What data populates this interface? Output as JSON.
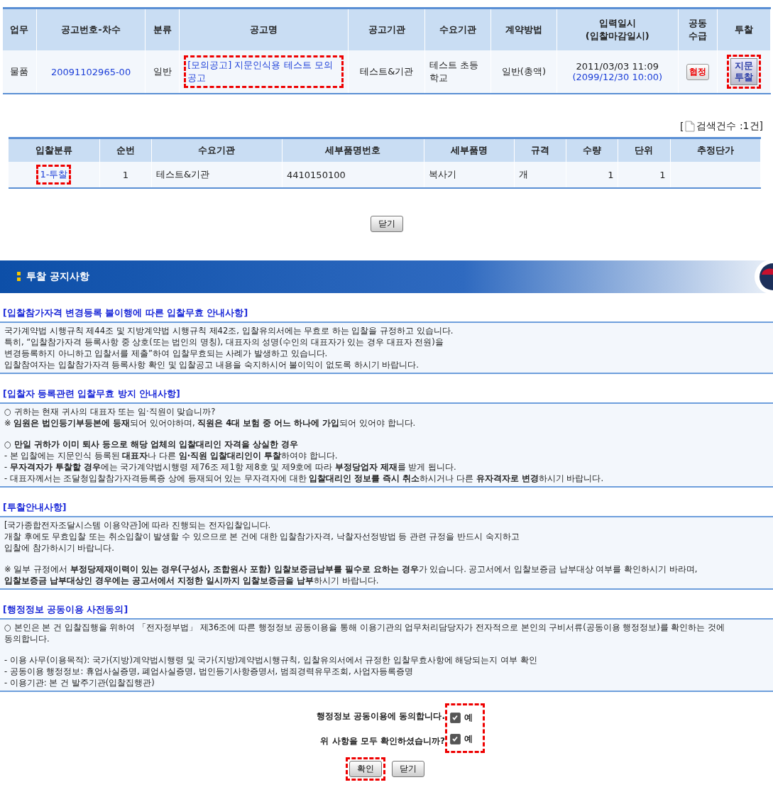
{
  "notice_table": {
    "columns": [
      "업무",
      "공고번호-차수",
      "분류",
      "공고명",
      "공고기관",
      "수요기관",
      "계약방법",
      "입력일시\n(입찰마감일시)",
      "공동\n수급",
      "투찰"
    ],
    "rows": [
      {
        "business": "물품",
        "number": "20091102965-00",
        "category": "일반",
        "title": "[모의공고] 지문인식용 테스트 모의공고",
        "title_highlighted": true,
        "agency": "테스트&기관",
        "demand_agency": "테스트 초등학교",
        "method": "일반(총액)",
        "entered": "2011/03/03 11:09",
        "deadline": "(2099/12/30 10:00)",
        "joint": "협정",
        "bid_button": "지문 투찰",
        "bid_highlighted": true
      }
    ]
  },
  "search_count": {
    "open": "[",
    "label": "검색건수 :1건]"
  },
  "items_table": {
    "columns": [
      "입찰분류",
      "순번",
      "수요기관",
      "세부품명번호",
      "세부품명",
      "규격",
      "수량",
      "단위",
      "추정단가"
    ],
    "rows": [
      {
        "bid_type": "1-투찰",
        "bid_type_highlighted": true,
        "seq": "1",
        "agency": "테스트&기관",
        "item_no": "4410150100",
        "item_name": "복사기",
        "spec": "개",
        "quantity": "1",
        "unit": "1"
      }
    ]
  },
  "close_button": "닫기",
  "banner": {
    "title": "투찰 공지사항"
  },
  "sections": [
    {
      "title": "[입찰참가자격 변경등록 불이행에 따른 입찰무효 안내사항]",
      "blocks": [
        [
          "국가계약법 시행규칙 제44조 및 지방계약법 시행규칙 제42조, 입찰유의서에는 무효로 하는 입찰을 규정하고 있습니다.",
          "특히, “입찰참가자격 등록사항 중 상호(또는 법인의 명칭), 대표자의 성명(수인의 대표자가 있는 경우 대표자 전원)을",
          "변경등록하지 아니하고 입찰서를 제출”하여 입찰무효되는 사례가 발생하고 있습니다.",
          "입찰참여자는 입찰참가자격 등록사항 확인 및 입찰공고 내용을 숙지하시어 불이익이 없도록 하시기 바랍니다."
        ]
      ]
    },
    {
      "title": "[입찰자 등록관련 입찰무효 방지 안내사항]",
      "blocks": [
        [
          "○ 귀하는 현재 귀사의 대표자 또는 임·직원이 맞습니까?",
          "※ **임원은 법인등기부등본에 등재**되어 있어야하며, **직원은 4대 보험 중 어느 하나에 가입**되어 있어야 합니다."
        ],
        [
          "○ **만일 귀하가 이미 퇴사 등으로 해당 업체의 입찰대리인 자격을 상실한 경우**",
          "- 본 입찰에는 지문인식 등록된 **대표자**나 다른 **임·직원 입찰대리인이 투찰**하여야 합니다.",
          "- **무자격자가 투찰할 경우**에는 국가계약법시행령 제76조 제1항 제8호 및 제9호에 따라 **부정당업자 제재**를 받게 됩니다.",
          "- 대표자께서는 조달청입찰참가자격등록증 상에 등재되어 있는 무자격자에 대한 **입찰대리인 정보를 즉시 취소**하시거나 다른 **유자격자로 변경**하시기 바랍니다."
        ]
      ]
    },
    {
      "title": "[투찰안내사항]",
      "blocks": [
        [
          "[국가종합전자조달시스템 이용약관]에 따라 진행되는 전자입찰입니다.",
          "개찰 후에도 무효입찰 또는 취소입찰이 발생할 수 있으므로 본 건에 대한 입찰참가자격, 낙찰자선정방법 등 관련 규정을 반드시 숙지하고",
          "입찰에 참가하시기 바랍니다."
        ],
        [
          "※ 일부 규정에서 **부정당제재이력이 있는 경우(구성사, 조합원사 포함) 입찰보증금납부를 필수로 요하는 경우**가 있습니다. 공고서에서 입찰보증금 납부대상 여부를 확인하시기 바라며,",
          "**입찰보증금 납부대상인 경우에는 공고서에서 지정한 일시까지 입찰보증금을 납부**하시기 바랍니다."
        ]
      ]
    },
    {
      "title": "[행정정보 공동이용 사전동의]",
      "blocks": [
        [
          "○ 본인은 본 건 입찰집행을 위하여 「전자정부법」 제36조에 따른 행정정보 공동이용을 통해 이용기관의 업무처리담당자가 전자적으로 본인의 구비서류(공동이용 행정정보)를 확인하는 것에",
          "동의합니다."
        ],
        [
          "- 이용 사무(이용목적): 국가(지방)계약법시행령 및 국가(지방)계약법시행규칙, 입찰유의서에서 규정한 입찰무효사항에 해당되는지 여부 확인",
          "- 공동이용 행정정보: 휴업사실증명, 폐업사실증명, 법인등기사항증명서, 범죄경력유무조회, 사업자등록증명",
          "- 이용기관: 본 건 발주기관(입찰집행관)"
        ]
      ]
    }
  ],
  "consent": {
    "highlighted": true,
    "questions": [
      {
        "label": "행정정보 공동이용에 동의합니다.",
        "checked": true,
        "option": "예"
      },
      {
        "label": "위 사항을 모두 확인하셨습니까?",
        "checked": true,
        "option": "예"
      }
    ]
  },
  "buttons": [
    {
      "label": "확인",
      "highlighted": true
    },
    {
      "label": "닫기",
      "highlighted": false
    }
  ]
}
